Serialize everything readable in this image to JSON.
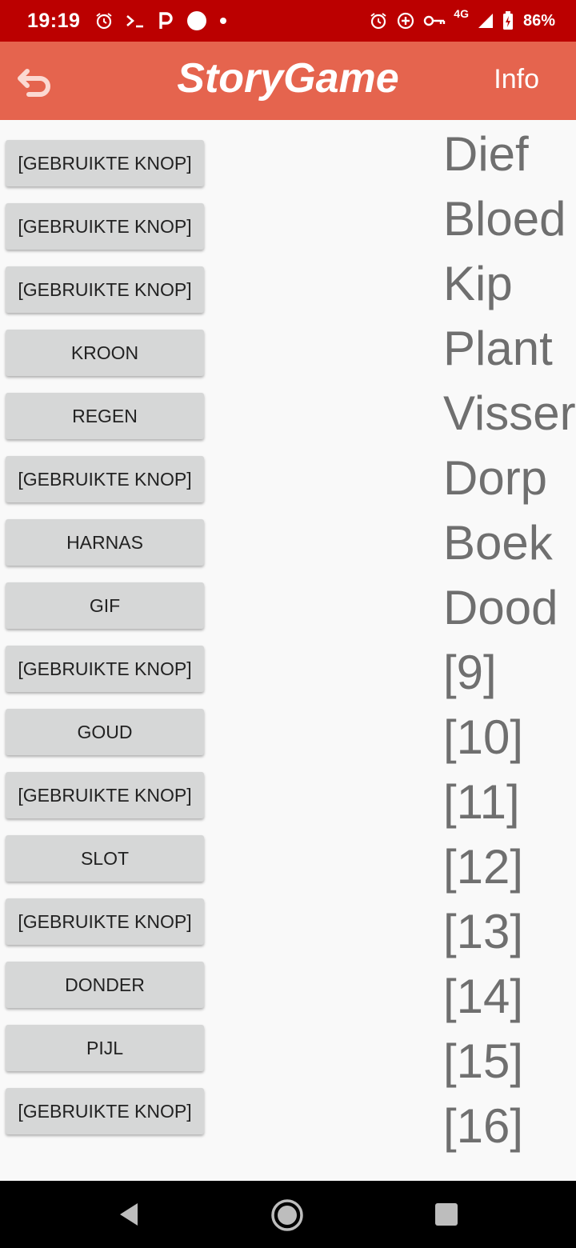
{
  "status_bar": {
    "time": "19:19",
    "network": "4G",
    "battery": "86%"
  },
  "app_bar": {
    "title": "StoryGame",
    "info_label": "Info"
  },
  "rows": [
    {
      "button": "[GEBRUIKTE KNOP]",
      "word": "Dief"
    },
    {
      "button": "[GEBRUIKTE KNOP]",
      "word": "Bloed"
    },
    {
      "button": "[GEBRUIKTE KNOP]",
      "word": "Kip"
    },
    {
      "button": "KROON",
      "word": "Plant"
    },
    {
      "button": "REGEN",
      "word": "Visser"
    },
    {
      "button": "[GEBRUIKTE KNOP]",
      "word": "Dorp"
    },
    {
      "button": "HARNAS",
      "word": "Boek"
    },
    {
      "button": "GIF",
      "word": "Dood"
    },
    {
      "button": "[GEBRUIKTE KNOP]",
      "word": "[9]"
    },
    {
      "button": "GOUD",
      "word": "[10]"
    },
    {
      "button": "[GEBRUIKTE KNOP]",
      "word": "[11]"
    },
    {
      "button": "SLOT",
      "word": "[12]"
    },
    {
      "button": "[GEBRUIKTE KNOP]",
      "word": "[13]"
    },
    {
      "button": "DONDER",
      "word": "[14]"
    },
    {
      "button": "PIJL",
      "word": "[15]"
    },
    {
      "button": "[GEBRUIKTE KNOP]",
      "word": "[16]"
    }
  ],
  "colors": {
    "status_bar": "#bb0000",
    "app_bar": "#e5644e",
    "button_bg": "#d6d7d7",
    "slot_text": "#6f6f6f"
  }
}
